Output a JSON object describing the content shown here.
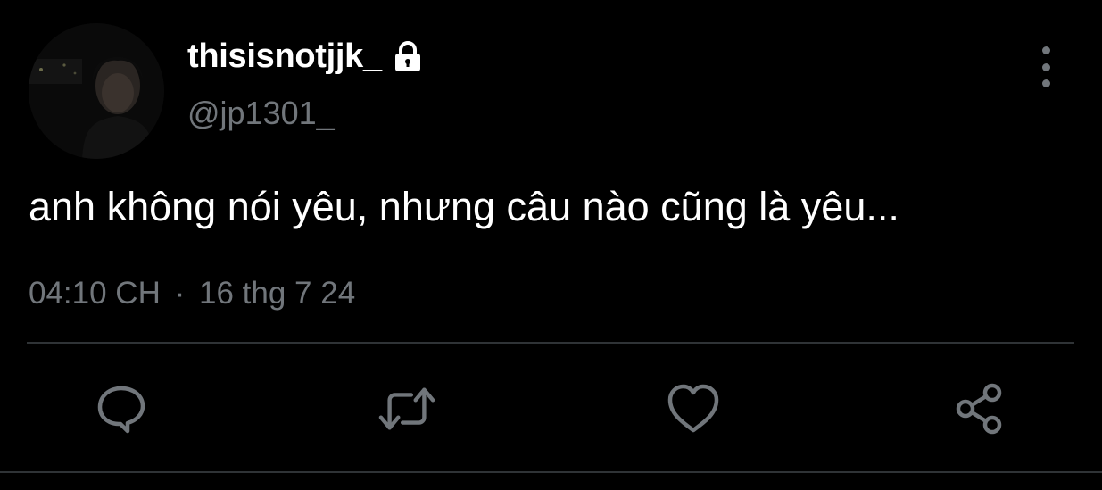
{
  "user": {
    "display_name": "thisisnotjjk_",
    "handle": "@jp1301_",
    "protected_icon": "lock-icon"
  },
  "tweet": {
    "text": "anh không nói yêu, nhưng câu nào cũng là yêu...",
    "time": "04:10 CH",
    "separator": "·",
    "date": "16 thg 7 24"
  },
  "actions": [
    {
      "icon": "reply-icon"
    },
    {
      "icon": "retweet-icon"
    },
    {
      "icon": "like-icon"
    },
    {
      "icon": "share-icon"
    }
  ],
  "colors": {
    "background": "#000000",
    "primary_text": "#ffffff",
    "secondary_text": "#71767b",
    "divider": "#2f3336"
  }
}
